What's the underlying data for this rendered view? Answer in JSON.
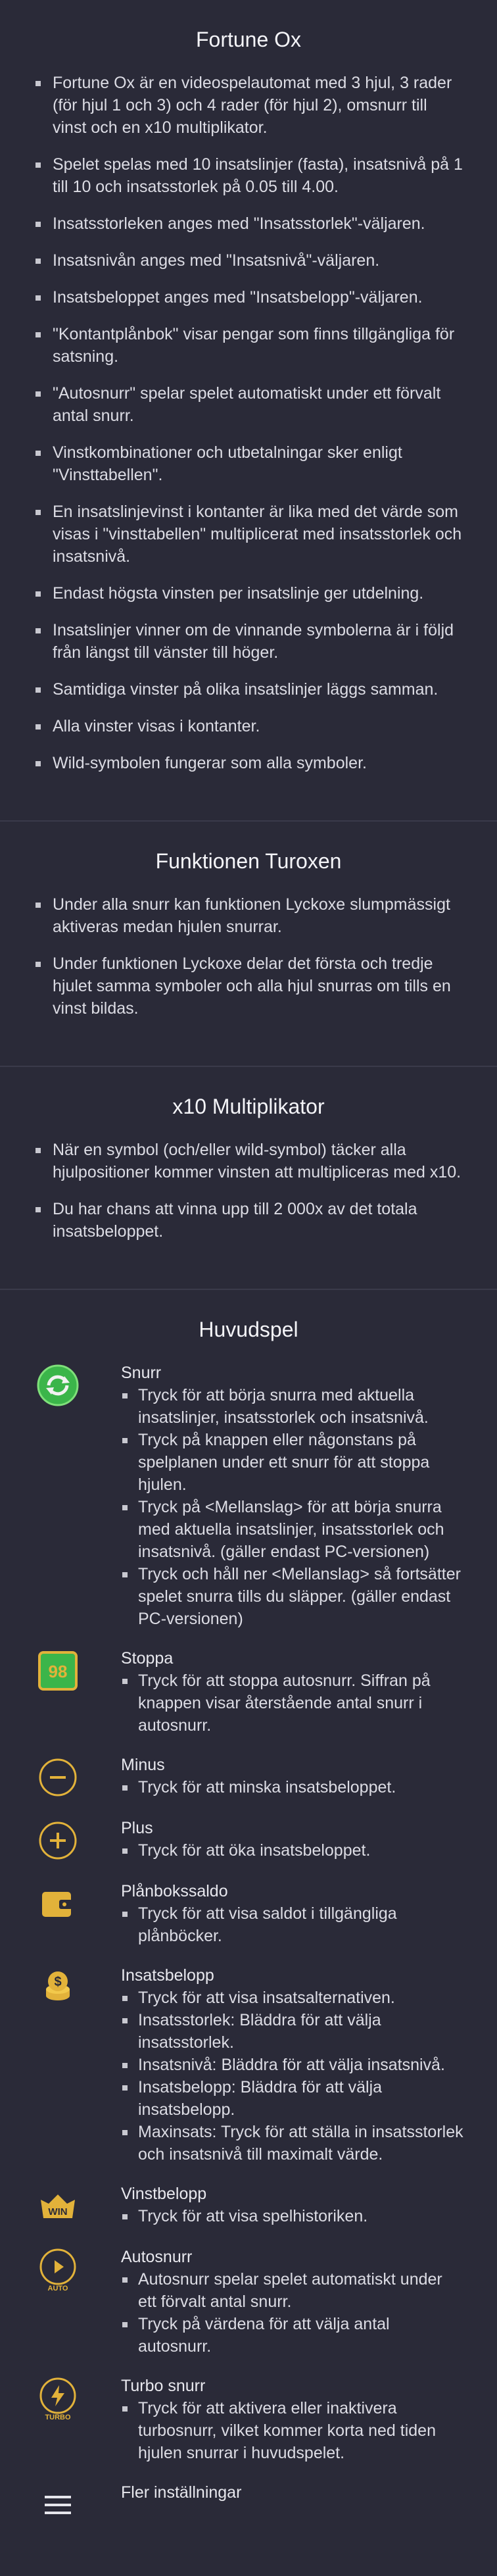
{
  "sections": {
    "game": {
      "title": "Fortune Ox",
      "items": [
        "Fortune Ox är en videospelautomat med 3 hjul, 3 rader (för hjul 1 och 3) och 4 rader (för hjul 2), omsnurr till vinst och en x10 multiplikator.",
        "Spelet spelas med 10 insatslinjer (fasta), insatsnivå på 1 till 10 och insatsstorlek på 0.05 till 4.00.",
        "Insatsstorleken anges med \"Insatsstorlek\"-väljaren.",
        "Insatsnivån anges med \"Insatsnivå\"-väljaren.",
        "Insatsbeloppet anges med \"Insatsbelopp\"-väljaren.",
        "\"Kontantplånbok\" visar pengar som finns tillgängliga för satsning.",
        "\"Autosnurr\" spelar spelet automatiskt under ett förvalt antal snurr.",
        "Vinstkombinationer och utbetalningar sker enligt \"Vinsttabellen\".",
        "En insatslinjevinst i kontanter är lika med det värde som visas i \"vinsttabellen\" multiplicerat med insatsstorlek och insatsnivå.",
        "Endast högsta vinsten per insatslinje ger utdelning.",
        "Insatslinjer vinner om de vinnande symbolerna är i följd från längst till vänster till höger.",
        "Samtidiga vinster på olika insatslinjer läggs samman.",
        "Alla vinster visas i kontanter.",
        "Wild-symbolen fungerar som alla symboler."
      ]
    },
    "turox": {
      "title": "Funktionen Turoxen",
      "items": [
        "Under alla snurr kan funktionen Lyckoxe slumpmässigt aktiveras medan hjulen snurrar.",
        "Under funktionen Lyckoxe delar det första och tredje hjulet samma symboler och alla hjul snurras om tills en vinst bildas."
      ]
    },
    "multiplier": {
      "title": "x10 Multiplikator",
      "items": [
        "När en symbol (och/eller wild-symbol) täcker alla hjulpositioner kommer vinsten att multipliceras med x10.",
        "Du har chans att vinna upp till 2 000x av det totala insatsbeloppet."
      ]
    },
    "main": {
      "title": "Huvudspel",
      "features": [
        {
          "icon": "spin-icon",
          "name": "Snurr",
          "lines": [
            "Tryck för att börja snurra med aktuella insatslinjer, insatsstorlek och insatsnivå.",
            "Tryck på knappen eller någonstans på spelplanen under ett snurr för att stoppa hjulen.",
            "Tryck på <Mellanslag> för att börja snurra med aktuella insatslinjer, insatsstorlek och insatsnivå. (gäller endast PC-versionen)",
            "Tryck och håll ner <Mellanslag> så fortsätter spelet snurra tills du släpper. (gäller endast PC-versionen)"
          ]
        },
        {
          "icon": "stop-icon",
          "name": "Stoppa",
          "badge": "98",
          "lines": [
            "Tryck för att stoppa autosnurr. Siffran på knappen visar återstående antal snurr i autosnurr."
          ]
        },
        {
          "icon": "minus-icon",
          "name": "Minus",
          "lines": [
            "Tryck för att minska insatsbeloppet."
          ]
        },
        {
          "icon": "plus-icon",
          "name": "Plus",
          "lines": [
            "Tryck för att öka insatsbeloppet."
          ]
        },
        {
          "icon": "wallet-icon",
          "name": "Plånbokssaldo",
          "lines": [
            "Tryck för att visa saldot i tillgängliga plånböcker."
          ]
        },
        {
          "icon": "bet-coins-icon",
          "name": "Insatsbelopp",
          "lines": [
            "Tryck för att visa insatsalternativen.",
            "Insatsstorlek: Bläddra för att välja insatsstorlek.",
            "Insatsnivå: Bläddra för att välja insatsnivå.",
            "Insatsbelopp: Bläddra för att välja insatsbelopp.",
            "Maxinsats: Tryck för att ställa in insatsstorlek och insatsnivå till maximalt värde."
          ]
        },
        {
          "icon": "win-icon",
          "name": "Vinstbelopp",
          "badge": "WIN",
          "lines": [
            "Tryck för att visa spelhistoriken."
          ]
        },
        {
          "icon": "auto-icon",
          "name": "Autosnurr",
          "badge": "AUTO",
          "lines": [
            "Autosnurr spelar spelet automatiskt under ett förvalt antal snurr.",
            "Tryck på värdena för att välja antal autosnurr."
          ]
        },
        {
          "icon": "turbo-icon",
          "name": "Turbo snurr",
          "badge": "TURBO",
          "lines": [
            "Tryck för att aktivera eller inaktivera turbosnurr, vilket kommer korta ned tiden hjulen snurrar i huvudspelet."
          ]
        },
        {
          "icon": "menu-icon",
          "name": "Fler inställningar",
          "lines": []
        }
      ]
    }
  },
  "colors": {
    "background": "#2a2a38",
    "gold": "#e2b23a",
    "green": "#3bb54a"
  }
}
